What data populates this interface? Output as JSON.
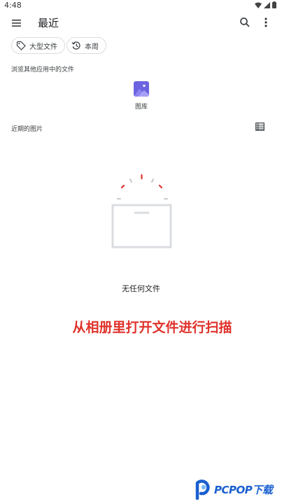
{
  "status": {
    "time": "4:48"
  },
  "header": {
    "title": "最近"
  },
  "filters": [
    {
      "label": "大型文件",
      "icon": "tag-icon"
    },
    {
      "label": "本周",
      "icon": "history-icon"
    }
  ],
  "browse": {
    "section_label": "浏览其他应用中的文件",
    "apps": [
      {
        "label": "图库",
        "icon": "gallery-icon",
        "color": "#6c63e0"
      }
    ]
  },
  "recent": {
    "section_label": "近期的图片",
    "empty_text": "无任何文件"
  },
  "overlay": {
    "caption": "从相册里打开文件进行扫描",
    "color": "#e0322b"
  },
  "watermark": {
    "brand": "PCPOP下载"
  }
}
